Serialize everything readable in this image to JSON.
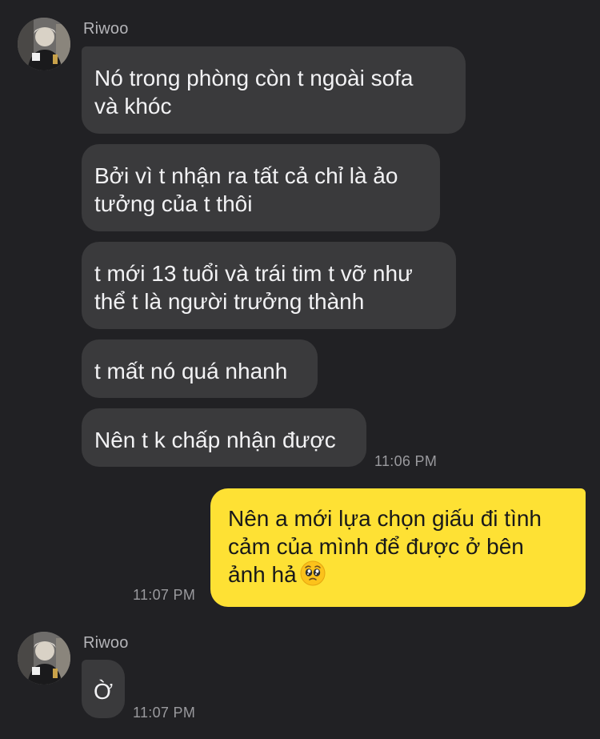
{
  "chat": {
    "contact_name": "Riwoo",
    "groups": [
      {
        "sender": "Riwoo",
        "messages": [
          {
            "lines": [
              "Nó trong phòng còn t ngoài sofa",
              "và khóc"
            ]
          },
          {
            "lines": [
              "Bởi vì t nhận ra tất cả chỉ là ảo",
              "tưởng của t thôi"
            ]
          },
          {
            "lines": [
              "t mới 13 tuổi và trái tim t vỡ như",
              "thể t là người trưởng thành"
            ]
          },
          {
            "lines": [
              "t mất nó quá nhanh"
            ]
          },
          {
            "lines": [
              "Nên t k chấp nhận được"
            ]
          }
        ],
        "time": "11:06 PM"
      },
      {
        "sender": "me",
        "messages": [
          {
            "lines": [
              "Nên a mới lựa chọn giấu đi tình",
              "cảm của mình để được ở bên",
              "ảnh hả"
            ],
            "emoji": "pleading-face"
          }
        ],
        "time": "11:07 PM"
      },
      {
        "sender": "Riwoo",
        "messages": [
          {
            "lines": [
              "Ờ"
            ]
          }
        ],
        "time": "11:07 PM"
      }
    ]
  },
  "colors": {
    "background": "#212124",
    "incoming_bubble": "#3a3a3c",
    "outgoing_bubble": "#fee134",
    "timestamp": "#9a9a9e"
  }
}
